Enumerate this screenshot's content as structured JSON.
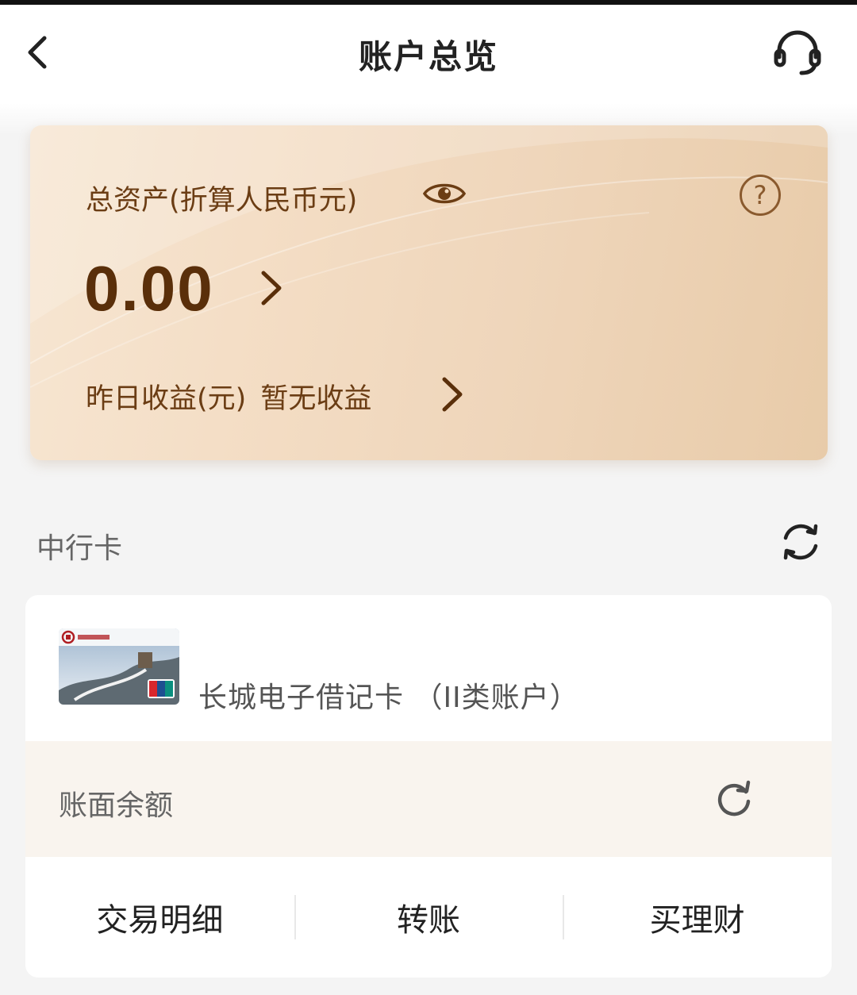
{
  "header": {
    "title": "账户总览",
    "back_icon": "chevron-left-icon",
    "service_icon": "headset-icon"
  },
  "assets": {
    "label": "总资产(折算人民币元)",
    "value": "0.00",
    "help_symbol": "?",
    "yesterday_label": "昨日收益(元)",
    "yesterday_status": "暂无收益"
  },
  "section": {
    "title": "中行卡"
  },
  "card": {
    "name": "长城电子借记卡 （II类账户）",
    "balance_label": "账面余额",
    "actions": [
      "交易明细",
      "转账",
      "买理财"
    ]
  },
  "colors": {
    "brand_brown": "#6b3d14",
    "card_gradient_start": "#f7e6d2",
    "card_gradient_end": "#e8cba9",
    "balance_row_bg": "#f9f4ee"
  }
}
